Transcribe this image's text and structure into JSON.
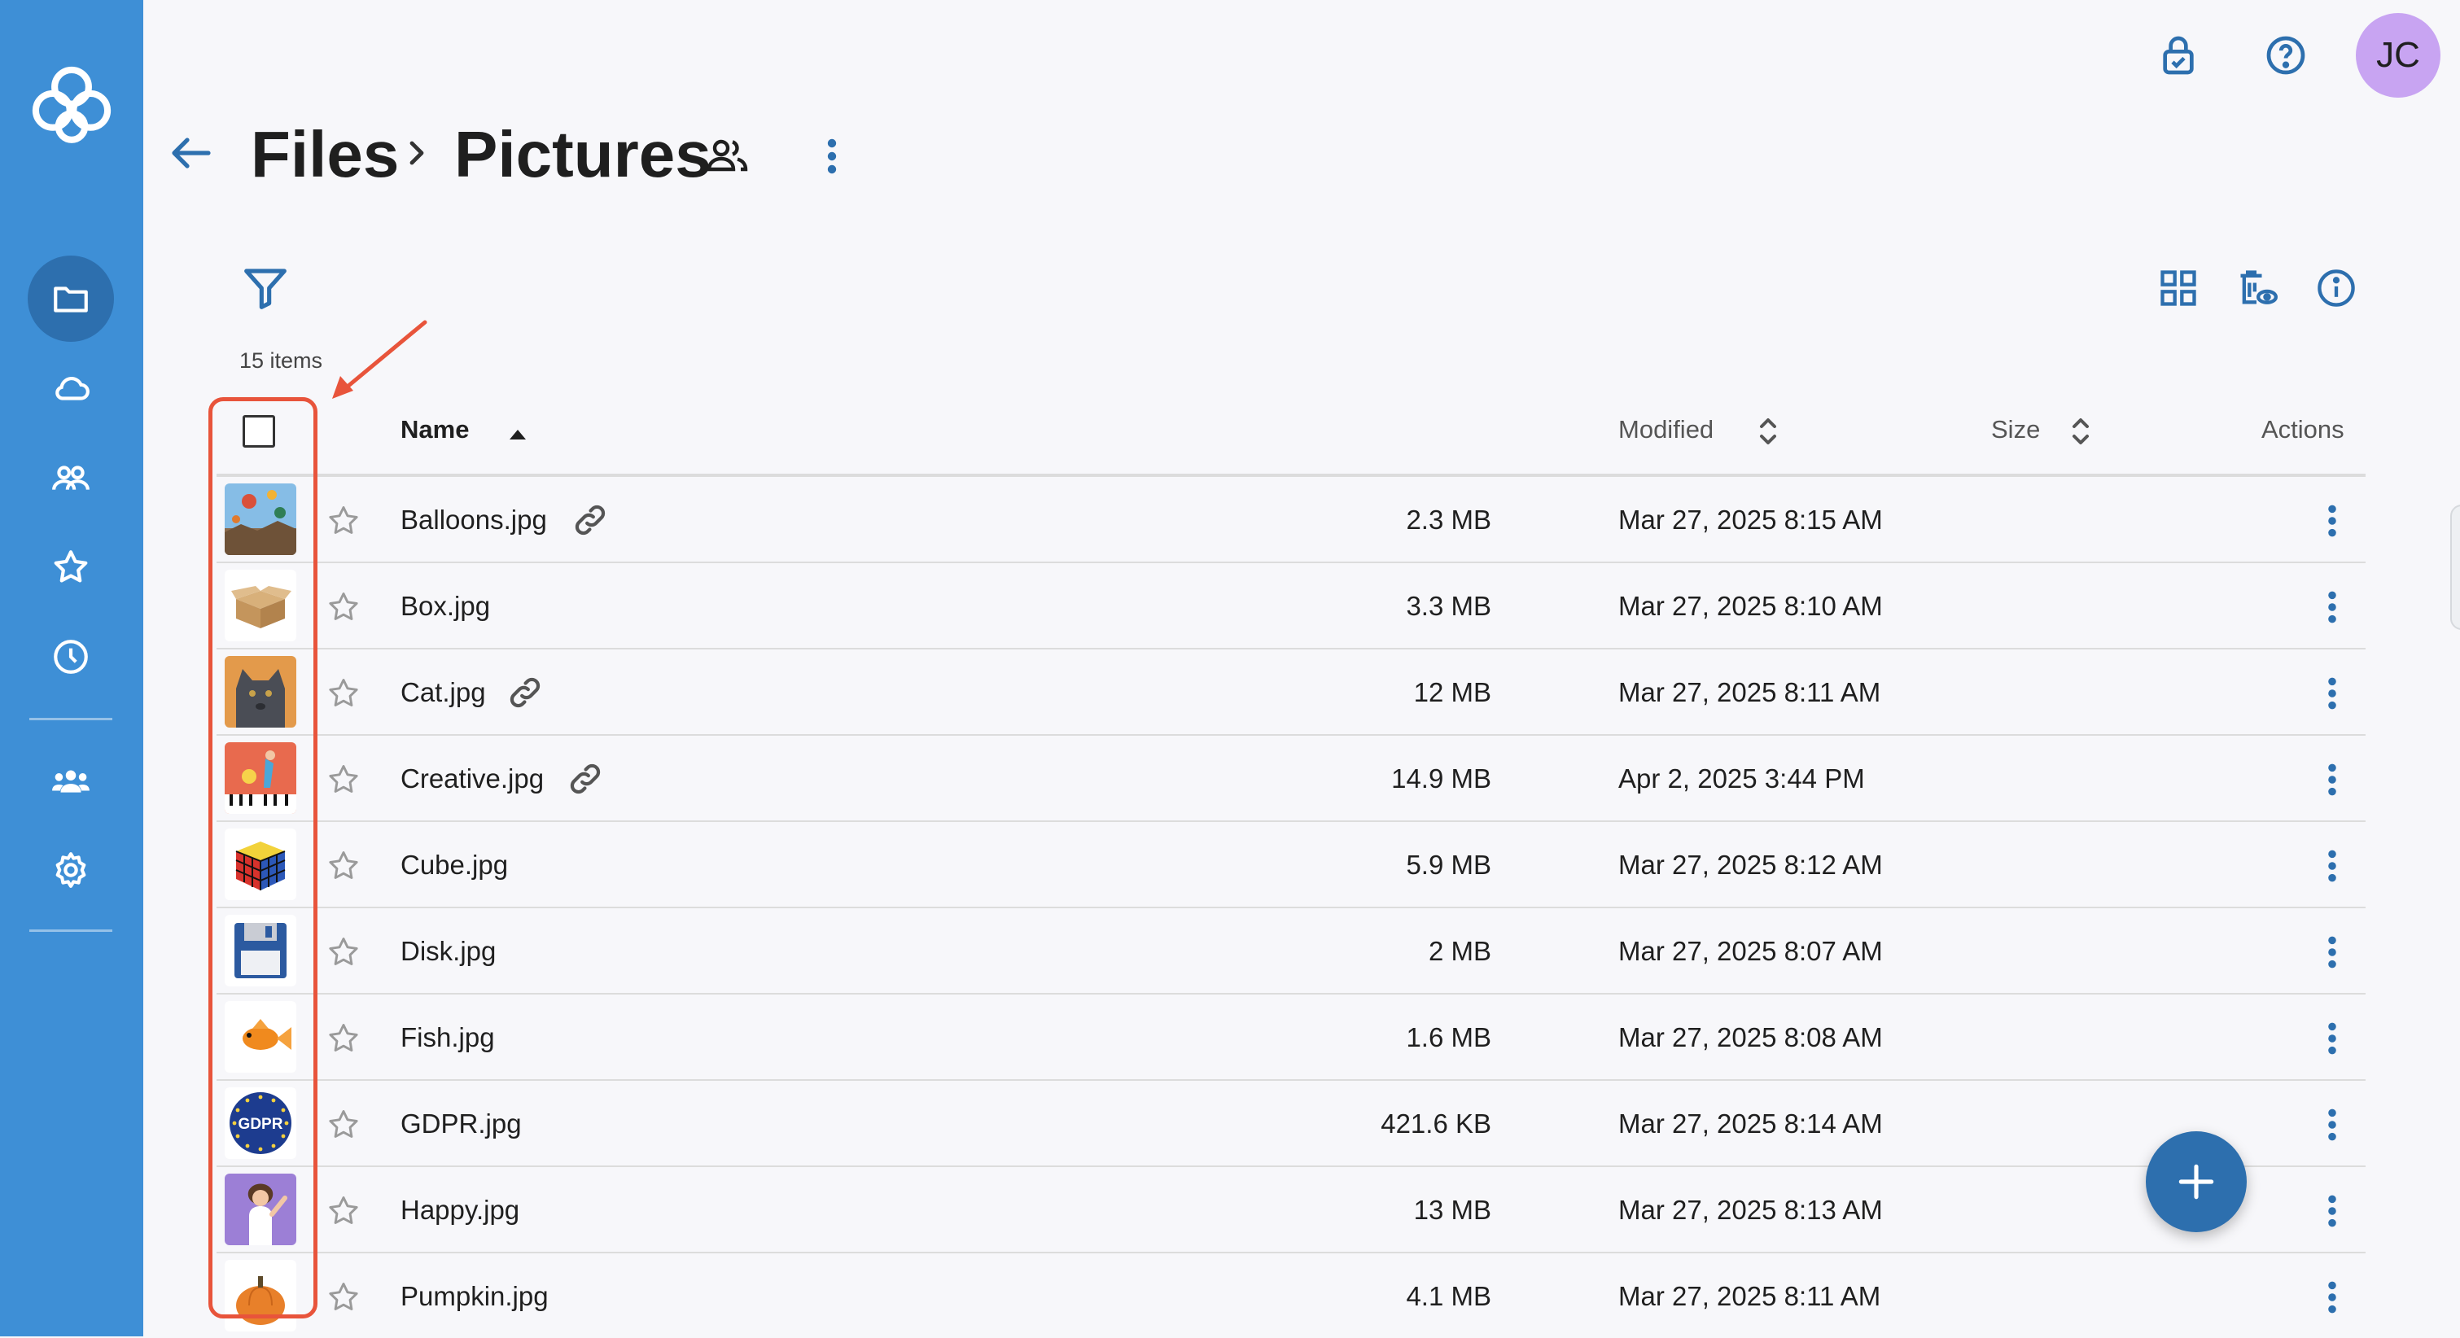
{
  "app": {
    "accent": "#3e8fd6",
    "avatar_initials": "JC"
  },
  "breadcrumb": {
    "root": "Files",
    "current": "Pictures"
  },
  "toolbar": {
    "items_count": "15 items"
  },
  "table": {
    "headers": {
      "name": "Name",
      "modified": "Modified",
      "size": "Size",
      "actions": "Actions"
    },
    "rows": [
      {
        "name": "Balloons.jpg",
        "modified": "Mar 27, 2025 8:15 AM",
        "size": "2.3 MB",
        "shared_link": true
      },
      {
        "name": "Box.jpg",
        "modified": "Mar 27, 2025 8:10 AM",
        "size": "3.3 MB",
        "shared_link": false
      },
      {
        "name": "Cat.jpg",
        "modified": "Mar 27, 2025 8:11 AM",
        "size": "12 MB",
        "shared_link": true
      },
      {
        "name": "Creative.jpg",
        "modified": "Apr 2, 2025 3:44 PM",
        "size": "14.9 MB",
        "shared_link": true
      },
      {
        "name": "Cube.jpg",
        "modified": "Mar 27, 2025 8:12 AM",
        "size": "5.9 MB",
        "shared_link": false
      },
      {
        "name": "Disk.jpg",
        "modified": "Mar 27, 2025 8:07 AM",
        "size": "2 MB",
        "shared_link": false
      },
      {
        "name": "Fish.jpg",
        "modified": "Mar 27, 2025 8:08 AM",
        "size": "1.6 MB",
        "shared_link": false
      },
      {
        "name": "GDPR.jpg",
        "modified": "Mar 27, 2025 8:14 AM",
        "size": "421.6 KB",
        "shared_link": false
      },
      {
        "name": "Happy.jpg",
        "modified": "Mar 27, 2025 8:13 AM",
        "size": "13 MB",
        "shared_link": false
      },
      {
        "name": "Pumpkin.jpg",
        "modified": "Mar 27, 2025 8:11 AM",
        "size": "4.1 MB",
        "shared_link": false
      }
    ]
  },
  "thumbnails": {
    "gdpr_text": "GDPR"
  }
}
